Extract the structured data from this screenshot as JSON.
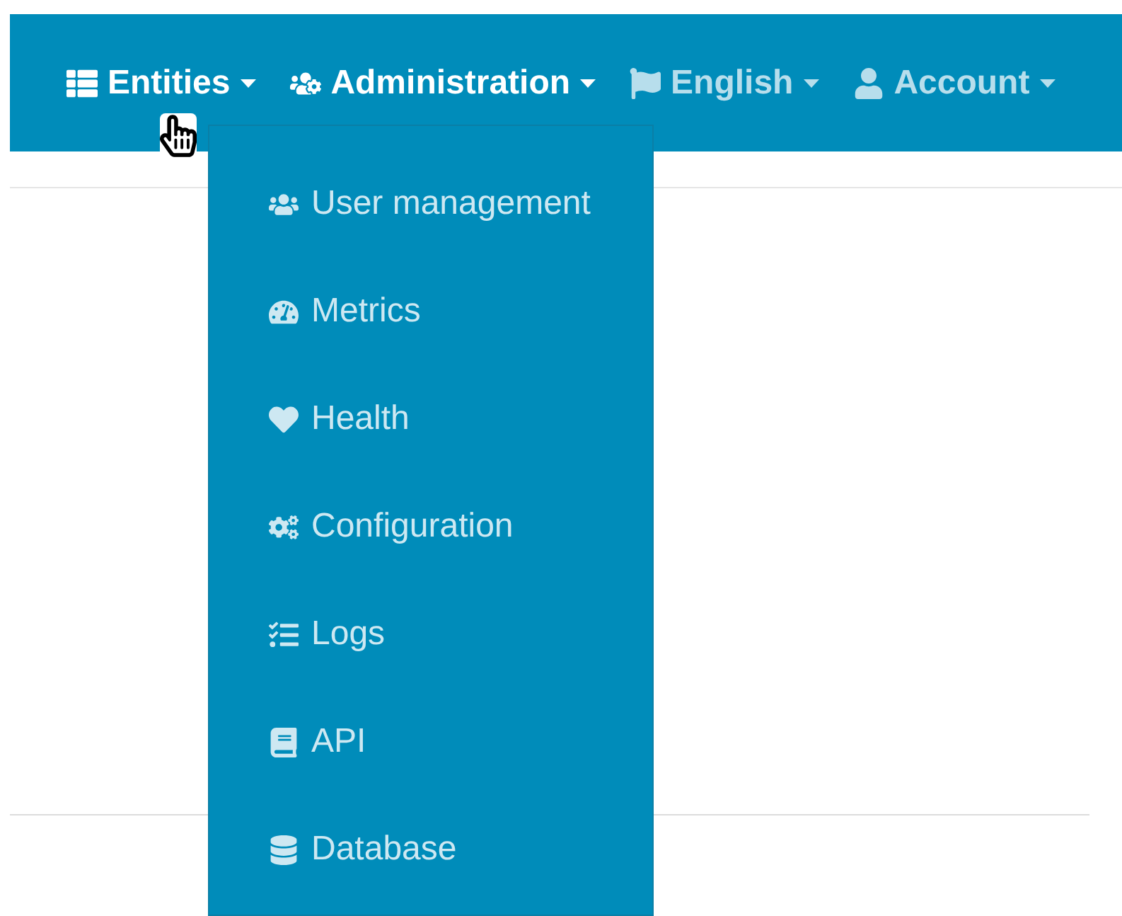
{
  "navbar": {
    "items": [
      {
        "label": "Entities",
        "dimmed": false
      },
      {
        "label": "Administration",
        "dimmed": false
      },
      {
        "label": "English",
        "dimmed": true
      },
      {
        "label": "Account",
        "dimmed": true
      }
    ]
  },
  "dropdown": {
    "items": [
      {
        "label": "User management"
      },
      {
        "label": "Metrics"
      },
      {
        "label": "Health"
      },
      {
        "label": "Configuration"
      },
      {
        "label": "Logs"
      },
      {
        "label": "API"
      },
      {
        "label": "Database"
      }
    ]
  }
}
